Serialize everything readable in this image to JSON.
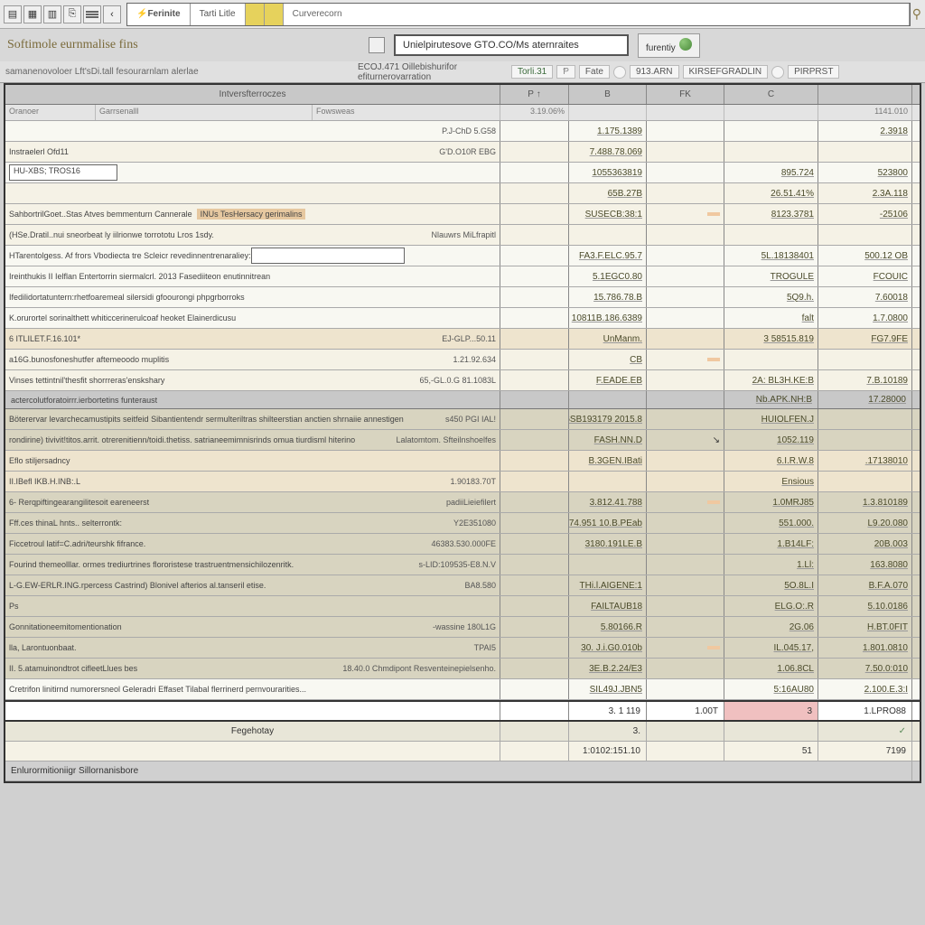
{
  "toolbar": {
    "back_icon": "‹",
    "tabs": [
      {
        "label": "Ferinite",
        "state": "active"
      },
      {
        "label": "Tarti Litle",
        "state": ""
      },
      {
        "label": "   ",
        "state": "yellow"
      },
      {
        "label": "   ",
        "state": "yellow"
      },
      {
        "label": "Curverecorn",
        "state": "wide"
      }
    ]
  },
  "header": {
    "title": "Softimole eurnmalise fins",
    "sub_title": "samanenovoloer Lft'sDi.tall fesourarnlam alerlae",
    "breadcrumb": "Unielpirutesove GTO.CO/Ms aternraites",
    "history_label": "furentiy",
    "context_label": "ECOJ.471 Oillebishurifor efiturnerovarration",
    "ctl_a": "Torli.31",
    "ctl_b": "Fate",
    "user_a": "913.ARN",
    "user_b": "KIRSEFGRADLIN",
    "user_c": "PIRPRST"
  },
  "columns": {
    "desc": "Intversfterroczes",
    "b": "P",
    "arrow": "↑",
    "c": "B",
    "d": "FK",
    "e": "C",
    "f": ""
  },
  "subcolumns": {
    "a": "Oranoer",
    "b": "Garrsenalll",
    "c": "Fowsweas",
    "d": "3.19.06%",
    "e": "",
    "f": ""
  },
  "rows": [
    {
      "desc": "",
      "val": "P.J-ChD 5.G58",
      "c": "1.175.1389",
      "d": "",
      "e": "",
      "f": "2.3918",
      "bg": "alt"
    },
    {
      "desc": "Instraelerl Ofd11",
      "val": "G'D.O10R EBG",
      "c": "7.488.78.069",
      "d": "",
      "e": "",
      "f": "",
      "bg": ""
    },
    {
      "desc": "HU-XBS; TROS16",
      "val": "",
      "c": "1055363819",
      "d": "",
      "e": "895.724",
      "f": "523800",
      "bg": "alt",
      "boxed": true
    },
    {
      "desc": "",
      "val": "",
      "c": "65B.27B",
      "d": "",
      "e": "26.51.41%",
      "f": "2.3A.118",
      "bg": ""
    },
    {
      "desc": "SahbortrilGoet..Stas Atves bemmenturn Cannerale",
      "val": "INUs TesHersacy gerimalins",
      "c": "SUSECB:38:1",
      "d": "",
      "e": "8123.3781",
      "f": "-25106",
      "bg": "",
      "chip": "true"
    },
    {
      "desc": "(HSe.Dratil..nui sneorbeat ly iilrionwe torrototu Lros 1sdy.",
      "val": "Nlauwrs      MiLfrapitl",
      "c": "",
      "d": "",
      "e": "",
      "f": "",
      "bg": ""
    },
    {
      "desc": "HTarentolgess. Af frors Vbodiecta tre Scleicr revedinnentrenaraliey:",
      "blank_input": true,
      "val": "",
      "c": "FA3.F.ELC.95.7",
      "d": "",
      "e": "5L.18138401",
      "f": "500.12 OB",
      "bg": "alt"
    },
    {
      "desc": "Ireinthukis II Ielflan Entertorrin siermalcrl. 2013 Fasediiteon enutinnitrean",
      "val": "",
      "c": "5.1EGC0.80",
      "d": "",
      "e": "TROGULE",
      "f": "FCOUIC",
      "bg": "alt"
    },
    {
      "desc": "Ifedilidortatuntern:rhetfoaremeal silersidi gfoourongi phpgrborroks",
      "val": "",
      "c": "15.786.78.B",
      "d": "",
      "e": "5Q9.h.",
      "f": "7.60018",
      "bg": "alt"
    },
    {
      "desc": "K.orurortel sorinalthett whiticcerinerulcoaf heoket Elainerdicusu",
      "val": "",
      "c": "10811B.186.6389",
      "d": "",
      "e": "falt",
      "f": "1.7.0800",
      "bg": "alt"
    },
    {
      "desc": "6 ITLILET.F.16.101*",
      "val": "EJ-GLP...50.11",
      "c": "UnManm.",
      "d": "",
      "e": "3 58515.819",
      "f": "FG7.9FE",
      "bg": "highlight"
    },
    {
      "desc": "a16G.bunosfoneshutfer aftemeoodo muplitis",
      "val": "1.21.92.634",
      "c": "CB",
      "d": "",
      "e": "",
      "f": "",
      "bg": ""
    },
    {
      "desc": "Vinses tettintnil'thesfit shorrreras'enskshary",
      "val": "65,-GL.0.G       81.1083L",
      "c": "F.EADE.EB",
      "d": "",
      "e": "2A: BL3H.KE:B",
      "f": "7.B.10189",
      "bg": ""
    },
    {
      "desc": "actercolutforatoirrr.ierbortetins                     funteraust",
      "val": "",
      "c": "",
      "d": "",
      "e": "Nb.APK.NH:B",
      "f": "17.28000",
      "bg": "gray",
      "section": true
    },
    {
      "desc": "Böterervar levarchecamustipits seitfeid Sibantientendr sermulteriltras shilteerstian anctien shrnaiie annestigen",
      "val": "s450 PGI IAL!",
      "c": "6SB193179 2015.8",
      "d": "",
      "e": "HUIOLFEN.J",
      "f": "",
      "bg": "dark",
      "tall": true
    },
    {
      "desc": "rondirine) tivivit!titos.arrit. otrerenitienn/toidi.thetiss. satrianeemimnisrinds\nomua tiurdisml hiterino",
      "val": "Lalatomtom.    Sfteilnshoelfes",
      "c": "FASH.NN.D",
      "d": "↘",
      "e": "1052.119",
      "f": "",
      "bg": "dark"
    },
    {
      "desc": "Eflo stiljersadncy",
      "val": "",
      "c": "B.3GEN.IBati",
      "d": "",
      "e": "6.I.R.W.8",
      "f": ".17138010",
      "bg": "highlight"
    },
    {
      "desc": "II.IBefl IKB.H.INB:.L",
      "val": "1.90183.70T",
      "c": "",
      "d": "",
      "e": "Ensious",
      "f": "",
      "bg": "highlight"
    },
    {
      "desc": "6- Rerqpiftingearangilitesoit eareneerst",
      "val": "padiiLieiefilert",
      "c": "3.812.41.788",
      "d": "",
      "e": "1.0MRJ85",
      "f": "1.3.810189",
      "bg": "dark"
    },
    {
      "desc": "Fff.ces thinaL hnts.. selterrontk:",
      "val": "Y2E351080",
      "c": "74.951 10.B.PEab",
      "d": "",
      "e": "551.000.",
      "f": "L9.20.080",
      "bg": "dark"
    },
    {
      "desc": "Ficcetroul latif=C.adri/teurshk fifrance.",
      "val": "46383.530.000FE",
      "c": "3180.191LE.B",
      "d": "",
      "e": "1.B14LF:",
      "f": "20B.003",
      "bg": "dark"
    },
    {
      "desc": "Fourind themeolllar. ormes trediurtrines flororistese trastruentmensichilozenritk.",
      "val": "s-LID:109535-E8.N.V",
      "c": "",
      "d": "",
      "e": "1.Ll:",
      "f": "163.8080",
      "bg": "dark"
    },
    {
      "desc": "L-G.EW-ERLR.ING.rpercess Castrind) Blonivel  afterios al.tanseril etise.",
      "val": "BA8.580",
      "c": "THi.l.AIGENE:1",
      "d": "",
      "e": "5O.8L.I",
      "f": "B.F.A.070",
      "bg": "dark"
    },
    {
      "desc": "Ps",
      "val": "",
      "c": "FAILTAUB18",
      "d": "",
      "e": "ELG.O:.R",
      "f": "5.10.0186",
      "bg": "dark"
    },
    {
      "desc": "Gonnitationeemitomentionation",
      "val": "-wassine 180L1G",
      "c": "5.80166.R",
      "d": "",
      "e": "2G.06",
      "f": "H.BT.0FIT",
      "bg": "dark"
    },
    {
      "desc": "lla, Larontuonbaat.",
      "val": "TPAI5",
      "c": "30. J.i.G0.010b",
      "d": "",
      "e": "IL.045.17,",
      "f": "1.801.0810",
      "bg": "dark"
    },
    {
      "desc": "II. 5.atamuinondtrot cifleetLlues bes",
      "val": "18.40.0     Chmdipont   Resventeinepielsenho.",
      "c": "3E.B.2.24/E3",
      "d": "",
      "e": "1.06.8CL",
      "f": "7.50.0:010",
      "bg": "dark"
    },
    {
      "desc": "Cretrifon linitirnd numorersneol Geleradri Effaset Tilabal flerrinerd pernvourarities...",
      "val": "",
      "c": "SIL49J.JBN5",
      "d": "",
      "e": "5:16AU80",
      "f": "2.100.E.3:I",
      "bg": "alt"
    }
  ],
  "totals": {
    "a": "3. 1 119",
    "b": "1.00T",
    "c": "3",
    "d": "1.LPRO88"
  },
  "footer_rows": [
    {
      "label": "Fegehotay",
      "a": "3.",
      "b": "",
      "c": "",
      "d": "✓"
    },
    {
      "label": "",
      "a": "1:0102:151.10",
      "b": "51",
      "c": "",
      "d": "7199"
    },
    {
      "label": "Enlurormitioniigr          Sillornanisbore",
      "a": "",
      "b": "",
      "c": "",
      "d": ""
    }
  ]
}
